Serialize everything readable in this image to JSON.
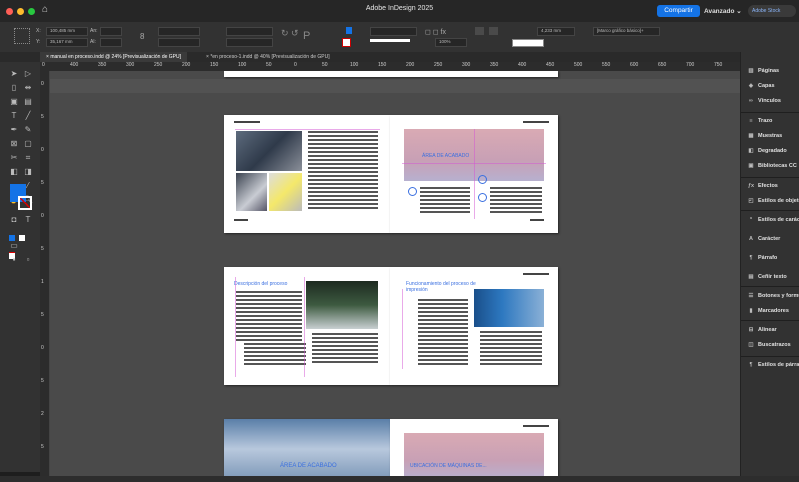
{
  "title_bar": {
    "home_icon": "home-icon",
    "app_title": "Adobe InDesign 2025",
    "share_label": "Compartir",
    "workspace_label": "Avanzado",
    "stock_search_placeholder": "Adobe Stock",
    "traffic_lights": {
      "close": "#ff5f57",
      "min": "#febc2e",
      "max": "#28c840"
    }
  },
  "control_panel": {
    "x_label": "X:",
    "x_value": "100,485 mm",
    "y_label": "Y:",
    "y_value": "35,167 mm",
    "w_label": "An:",
    "h_label": "Al:",
    "stroke_weight": "4,233 mm",
    "zoom_pct": "100%",
    "object_style": "[Marco gráfico básico]+"
  },
  "doc_tabs": [
    {
      "label": "manual en proceso.indd @ 24% [Previsualización de GPU]",
      "active": true
    },
    {
      "label": "*en proceso-1.indd @ 40% [Previsualización de GPU]",
      "active": false
    }
  ],
  "h_ruler": [
    "0",
    "400",
    "350",
    "300",
    "250",
    "200",
    "150",
    "100",
    "50",
    "0",
    "50",
    "100",
    "150",
    "200",
    "250",
    "300",
    "350",
    "400",
    "450",
    "500",
    "550",
    "600",
    "650",
    "700",
    "750"
  ],
  "v_ruler": [
    "0",
    "5",
    "0",
    "5",
    "0",
    "5",
    "1",
    "5",
    "0",
    "5",
    "2",
    "5"
  ],
  "spreads": {
    "s2_left_heading": "Descripción del proceso",
    "s2_right_heading": "Funcionamiento del proceso de impresión",
    "s1_right_label": "ÁREA DE ACABADO",
    "s3_left_label": "ÁREA DE ACABADO",
    "s3_right_label": "UBICACIÓN DE MÁQUINAS DE..."
  },
  "panels": [
    {
      "icon": "pages-icon",
      "label": "Páginas"
    },
    {
      "icon": "layers-icon",
      "label": "Capas"
    },
    {
      "icon": "links-icon",
      "label": "Vínculos"
    },
    {
      "icon": "stroke-icon",
      "label": "Trazo"
    },
    {
      "icon": "swatches-icon",
      "label": "Muestras"
    },
    {
      "icon": "gradient-icon",
      "label": "Degradado"
    },
    {
      "icon": "cc-libraries-icon",
      "label": "Bibliotecas CC"
    },
    {
      "icon": "effects-icon",
      "label": "Efectos"
    },
    {
      "icon": "object-styles-icon",
      "label": "Estilos de objeto"
    },
    {
      "icon": "char-styles-icon",
      "label": "Estilos de carácter"
    },
    {
      "icon": "character-icon",
      "label": "Carácter"
    },
    {
      "icon": "paragraph-icon",
      "label": "Párrafo"
    },
    {
      "icon": "text-wrap-icon",
      "label": "Ceñir texto"
    },
    {
      "icon": "buttons-forms-icon",
      "label": "Botones y formularios"
    },
    {
      "icon": "bookmarks-icon",
      "label": "Marcadores"
    },
    {
      "icon": "align-icon",
      "label": "Alinear"
    },
    {
      "icon": "pathfinder-icon",
      "label": "Buscatrazos"
    },
    {
      "icon": "para-styles-icon",
      "label": "Estilos de párrafo"
    }
  ],
  "accent_color": "#1473e6",
  "guide_color": "#d455d4"
}
